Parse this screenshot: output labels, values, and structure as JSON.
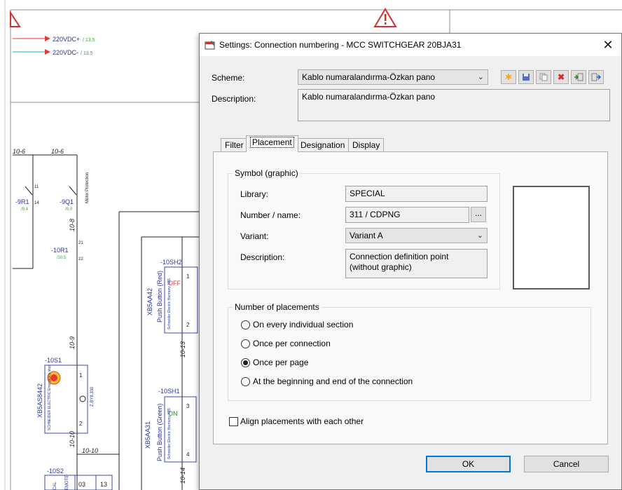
{
  "dialog": {
    "title": "Settings: Connection numbering - MCC SWITCHGEAR 20BJA31",
    "close_glyph": "✕",
    "scheme_label": "Scheme:",
    "scheme_value": "Kablo numaralandırma-Özkan pano",
    "description_label": "Description:",
    "description_value": "Kablo numaralandırma-Özkan pano",
    "toolbar_icons": [
      "new-icon",
      "save-icon",
      "copy-icon",
      "delete-icon",
      "import-icon",
      "export-icon"
    ],
    "tabs": [
      "Filter",
      "Placement",
      "Designation",
      "Display"
    ],
    "active_tab": "Placement",
    "symbol_group": {
      "title": "Symbol (graphic)",
      "library_label": "Library:",
      "library_value": "SPECIAL",
      "number_label": "Number / name:",
      "number_value": "311 / CDPNG",
      "browse_label": "...",
      "variant_label": "Variant:",
      "variant_value": "Variant A",
      "desc_label": "Description:",
      "desc_value_line1": "Connection definition point",
      "desc_value_line2": "(without graphic)"
    },
    "placements_group": {
      "title": "Number of placements",
      "options": [
        "On every individual section",
        "Once per connection",
        "Once per page",
        "At the beginning and end of the connection"
      ],
      "selected": "Once per page"
    },
    "align_label": "Align placements with each other",
    "align_checked": false,
    "ok_label": "OK",
    "cancel_label": "Cancel"
  },
  "schematic": {
    "wire_labels": [
      "220VDC+",
      "220VDC-"
    ],
    "wire_refs": [
      "/ 13.5",
      "/ 13.5"
    ],
    "wire_colors": [
      "#e53935",
      "#00bcd4"
    ],
    "net_labels": [
      "10-6",
      "10-6",
      "10-8",
      "10-9",
      "10-13",
      "10-10",
      "10-10",
      "10-14"
    ],
    "devices": [
      "-9R1",
      "-9Q1",
      "-10R1",
      "-10SH2",
      "-10S1",
      "-10SH1",
      "-10S2"
    ],
    "device_refs": [
      "/9.4",
      "/9.0",
      "/10.5"
    ],
    "vertical_texts": [
      "Motor Protection",
      "Push Button (Red)",
      "XB5AA42",
      "Push Button (Green)",
      "XB5AA31",
      "XB5AS8442",
      "SCHNEIDER ELECTRIC Emergency stop",
      "Schneider Electric Harmony XB5",
      "Z.BY8.330",
      "EMOTE",
      "CAL"
    ],
    "lamp_texts": [
      "OFF",
      "ON"
    ],
    "lamp_colors": [
      "#e53935",
      "#2e7d32"
    ],
    "terminals": [
      "1",
      "2",
      "3",
      "4",
      "11",
      "14",
      "21",
      "22",
      "13",
      "14",
      "03",
      "13"
    ],
    "warning_icon": "warning-triangle-icon"
  }
}
